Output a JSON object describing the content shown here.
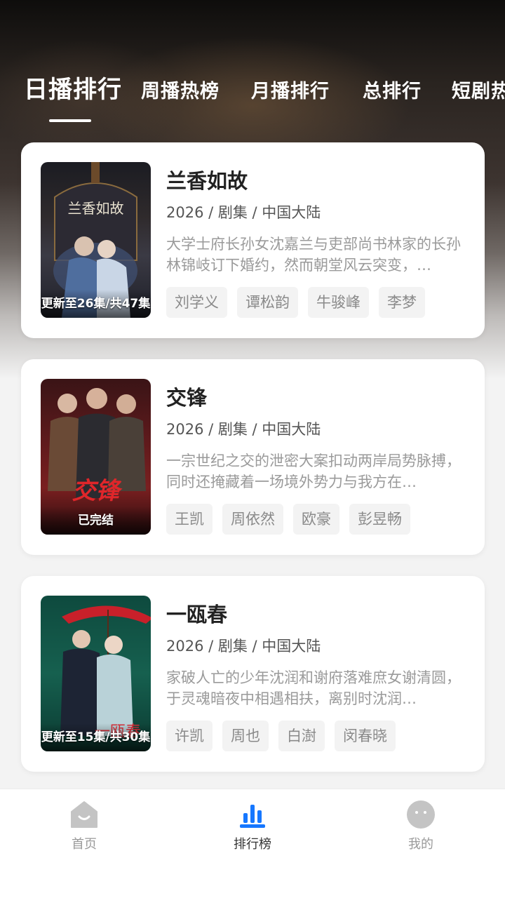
{
  "tabs": [
    {
      "label": "日播排行",
      "active": true
    },
    {
      "label": "周播热榜",
      "active": false
    },
    {
      "label": "月播排行",
      "active": false
    },
    {
      "label": "总排行",
      "active": false
    },
    {
      "label": "短剧热",
      "active": false
    }
  ],
  "items": [
    {
      "title": "兰香如故",
      "meta": "2026 / 剧集 / 中国大陆",
      "description": "大学士府长孙女沈嘉兰与吏部尚书林家的长孙林锦岐订下婚约，然而朝堂风云突变，…",
      "status": "更新至26集/共47集",
      "poster_title": "兰香如故",
      "tags": [
        "刘学义",
        "谭松韵",
        "牛骏峰",
        "李梦"
      ]
    },
    {
      "title": "交锋",
      "meta": "2026 / 剧集 / 中国大陆",
      "description": "一宗世纪之交的泄密大案扣动两岸局势脉搏，同时还掩藏着一场境外势力与我方在…",
      "status": "已完结",
      "poster_title": "交锋",
      "tags": [
        "王凯",
        "周依然",
        "欧豪",
        "彭昱畅"
      ]
    },
    {
      "title": "一瓯春",
      "meta": "2026 / 剧集 / 中国大陆",
      "description": "家破人亡的少年沈润和谢府落难庶女谢清圆，于灵魂暗夜中相遇相扶，离别时沈润…",
      "status": "更新至15集/共30集",
      "poster_title": "一瓯春",
      "tags": [
        "许凯",
        "周也",
        "白澍",
        "闵春晓"
      ]
    }
  ],
  "nav": [
    {
      "label": "首页",
      "icon": "home-icon",
      "active": false
    },
    {
      "label": "排行榜",
      "icon": "ranking-icon",
      "active": true
    },
    {
      "label": "我的",
      "icon": "profile-icon",
      "active": false
    }
  ],
  "colors": {
    "accent": "#1677ff",
    "nav_inactive": "#c4c4c4"
  }
}
